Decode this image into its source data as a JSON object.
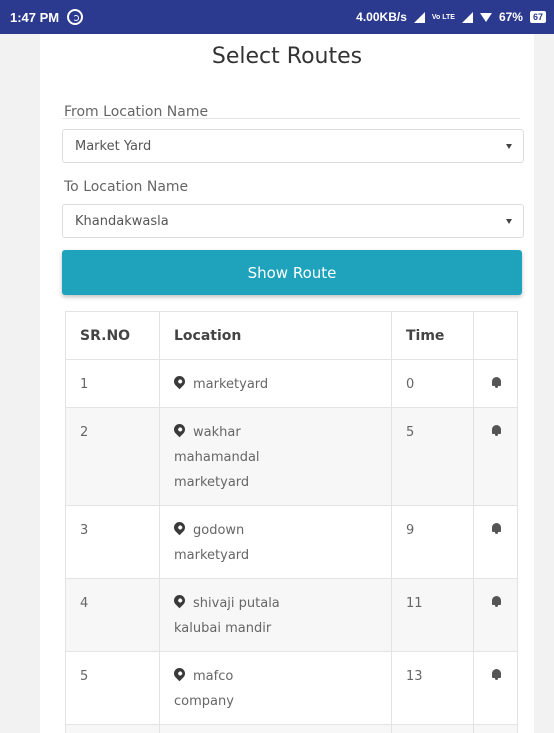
{
  "statusbar": {
    "time": "1:47 PM",
    "speed": "4.00KB/s",
    "volte": "Vo LTE",
    "battery_percent": "67%",
    "battery_icon_text": "67"
  },
  "page": {
    "title": "Select Routes"
  },
  "from": {
    "label": "From Location Name",
    "value": "Market Yard"
  },
  "to": {
    "label": "To Location Name",
    "value": "Khandakwasla"
  },
  "show_route_label": "Show Route",
  "table": {
    "headers": [
      "SR.NO",
      "Location",
      "Time",
      ""
    ],
    "rows": [
      {
        "sr": "1",
        "location_lines": [
          "marketyard"
        ],
        "time": "0"
      },
      {
        "sr": "2",
        "location_lines": [
          "wakhar",
          "mahamandal",
          "marketyard"
        ],
        "time": "5"
      },
      {
        "sr": "3",
        "location_lines": [
          "godown",
          "marketyard"
        ],
        "time": "9"
      },
      {
        "sr": "4",
        "location_lines": [
          "shivaji putala",
          "kalubai mandir"
        ],
        "time": "11"
      },
      {
        "sr": "5",
        "location_lines": [
          "mafco",
          "company"
        ],
        "time": "13"
      }
    ]
  },
  "colors": {
    "statusbar": "#2b3a8f",
    "button": "#1fa3bd"
  }
}
